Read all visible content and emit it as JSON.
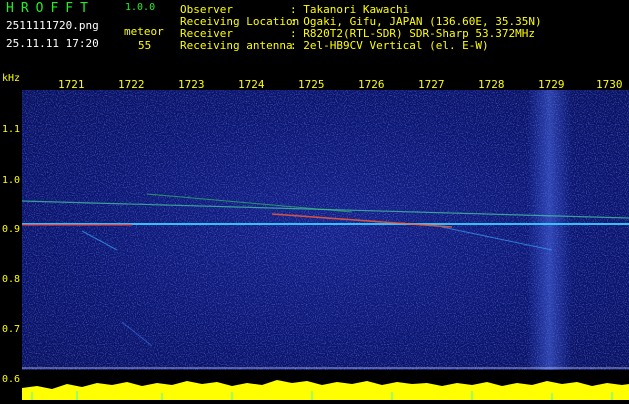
{
  "app": {
    "logo": "HROFFT",
    "version": "1.0.0"
  },
  "file": {
    "name": "2511111720.png",
    "datetime": "25.11.11 17:20",
    "mode_label": "meteor",
    "count": "55"
  },
  "info": [
    {
      "label": "Observer",
      "value": ": Takanori Kawachi"
    },
    {
      "label": "Receiving Location",
      "value": ": Ogaki, Gifu, JAPAN (136.60E, 35.35N)"
    },
    {
      "label": "Receiver",
      "value": ": R820T2(RTL-SDR) SDR-Sharp 53.372MHz"
    },
    {
      "label": "Receiving antenna",
      "value": ": 2el-HB9CV Vertical (el. E-W)"
    }
  ],
  "y_unit": "kHz",
  "time_ticks": [
    "1721",
    "1722",
    "1723",
    "1724",
    "1725",
    "1726",
    "1727",
    "1728",
    "1729",
    "1730"
  ],
  "freq_ticks": [
    "1.1",
    "1.0",
    "0.9",
    "0.8",
    "0.7",
    "0.6"
  ],
  "colors": {
    "background": "#000000",
    "header_green": "#22ee22",
    "axis_yellow": "#ffff00",
    "spectrum_blue": "#0a1470"
  }
}
